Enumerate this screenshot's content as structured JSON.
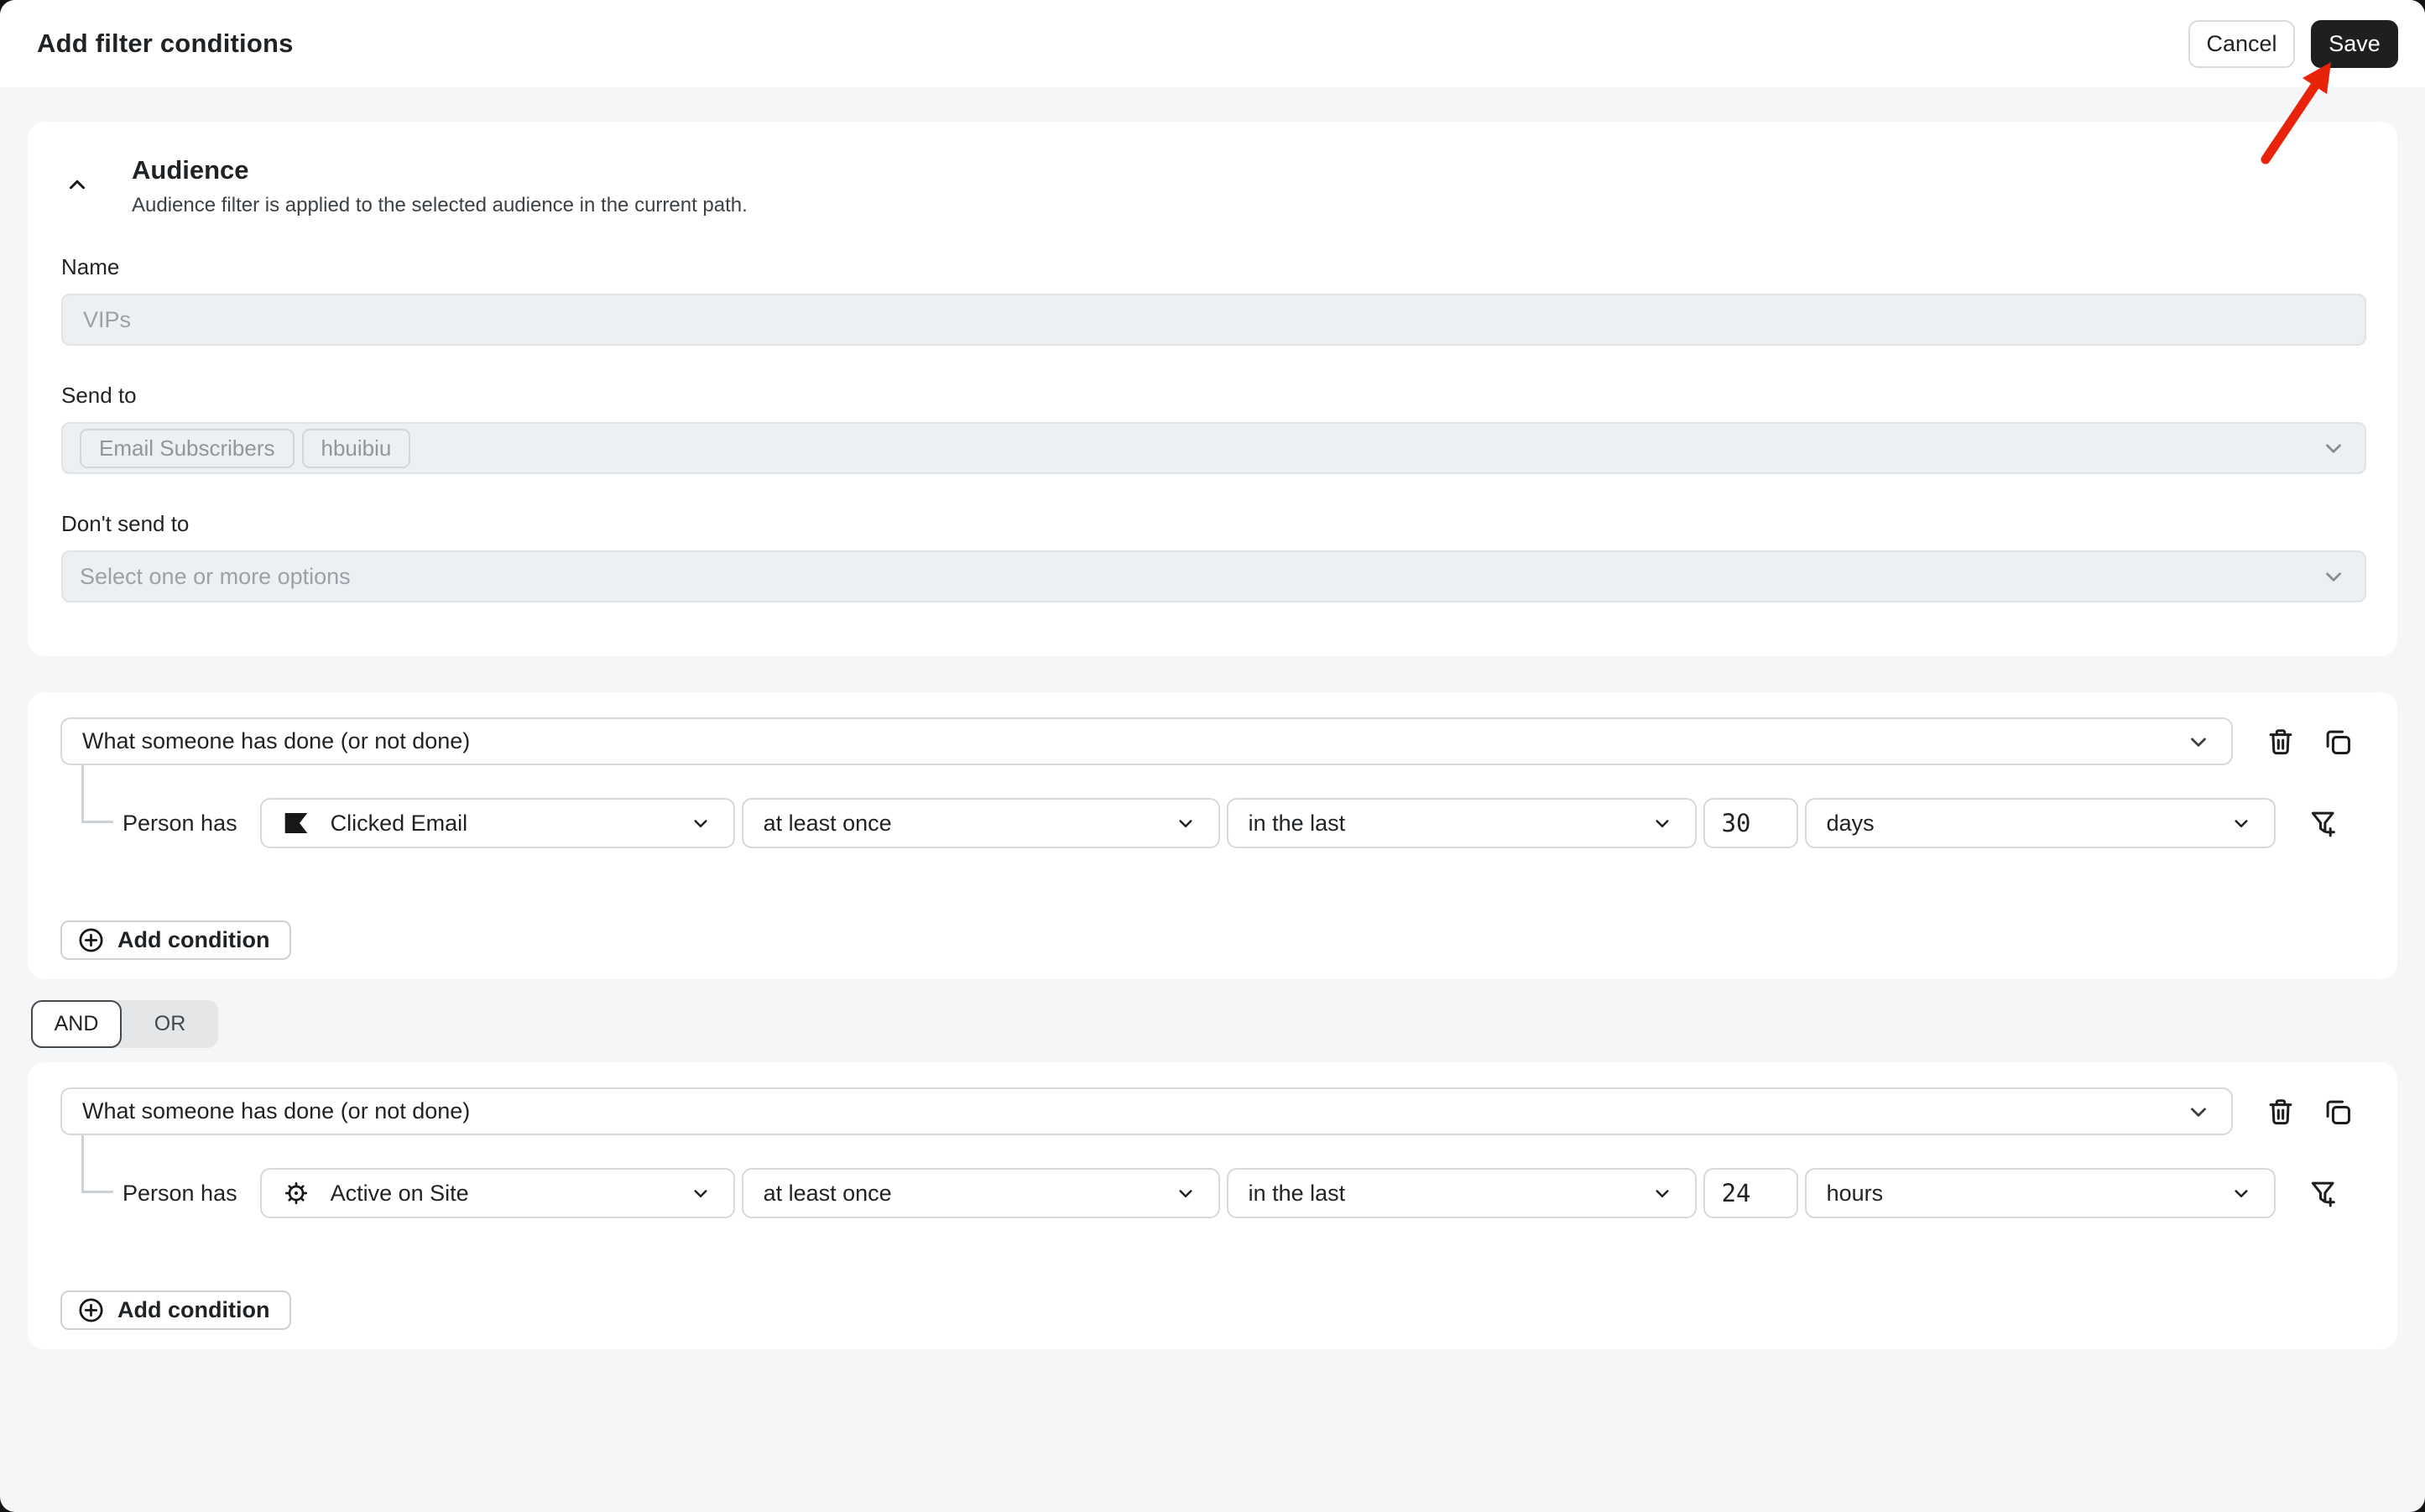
{
  "header": {
    "title": "Add filter conditions",
    "cancel_label": "Cancel",
    "save_label": "Save"
  },
  "annotation": {
    "type": "red-arrow-pointing-to-save",
    "color": "#e8230a"
  },
  "audience": {
    "title": "Audience",
    "subtitle": "Audience filter is applied to the selected audience in the current path.",
    "name_label": "Name",
    "name_placeholder": "VIPs",
    "send_to_label": "Send to",
    "send_to_tags": [
      "Email Subscribers",
      "hbuibiu"
    ],
    "dont_send_to_label": "Don't send to",
    "dont_send_to_placeholder": "Select one or more options"
  },
  "logic_toggle": {
    "and_label": "AND",
    "or_label": "OR",
    "selected": "AND"
  },
  "conditions": [
    {
      "type_selector": "What someone has done (or not done)",
      "subject_label": "Person has",
      "event": "Clicked Email",
      "event_icon": "flag-icon",
      "frequency": "at least once",
      "timeframe": "in the last",
      "amount": "30",
      "unit": "days",
      "add_condition_label": "Add condition"
    },
    {
      "type_selector": "What someone has done (or not done)",
      "subject_label": "Person has",
      "event": "Active on Site",
      "event_icon": "gear-icon",
      "frequency": "at least once",
      "timeframe": "in the last",
      "amount": "24",
      "unit": "hours",
      "add_condition_label": "Add condition"
    }
  ],
  "colors": {
    "page_bg": "#f5f6f8",
    "card_bg": "#ffffff",
    "input_bg": "#edf0f2",
    "save_button": "#1d1f21",
    "arrow_red": "#e8230a",
    "border": "#d5d9dc",
    "muted_text": "#9aa1a8"
  }
}
